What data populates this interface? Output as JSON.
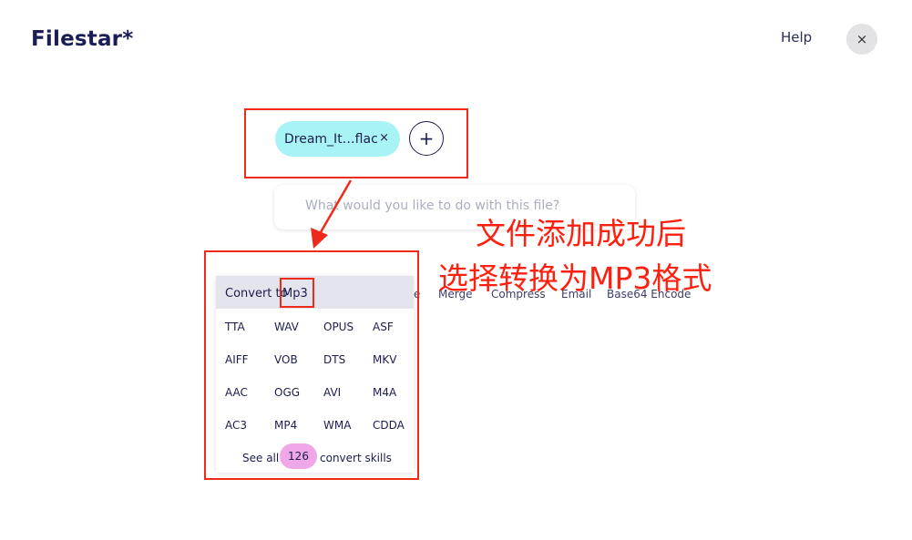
{
  "header": {
    "logo": "Filestar*",
    "help": "Help",
    "close": "×"
  },
  "file": {
    "name": "Dream_It…flac",
    "remove": "×",
    "add": "+"
  },
  "query": {
    "placeholder": "What would you like to do with this file?"
  },
  "skills": {
    "partial": "e",
    "items": [
      "Merge",
      "Compress",
      "Email",
      "Base64 Encode"
    ]
  },
  "menu": {
    "label": "Convert to",
    "value": "Mp3",
    "formats": [
      [
        "TTA",
        "WAV",
        "OPUS",
        "ASF"
      ],
      [
        "AIFF",
        "VOB",
        "DTS",
        "MKV"
      ],
      [
        "AAC",
        "OGG",
        "AVI",
        "M4A"
      ],
      [
        "AC3",
        "MP4",
        "WMA",
        "CDDA"
      ]
    ],
    "see_all": "See all",
    "count": "126",
    "suffix": "convert skills"
  },
  "annotation": {
    "line1": "文件添加成功后",
    "line2": "选择转换为MP3格式",
    "color": "#ff1f0f"
  }
}
